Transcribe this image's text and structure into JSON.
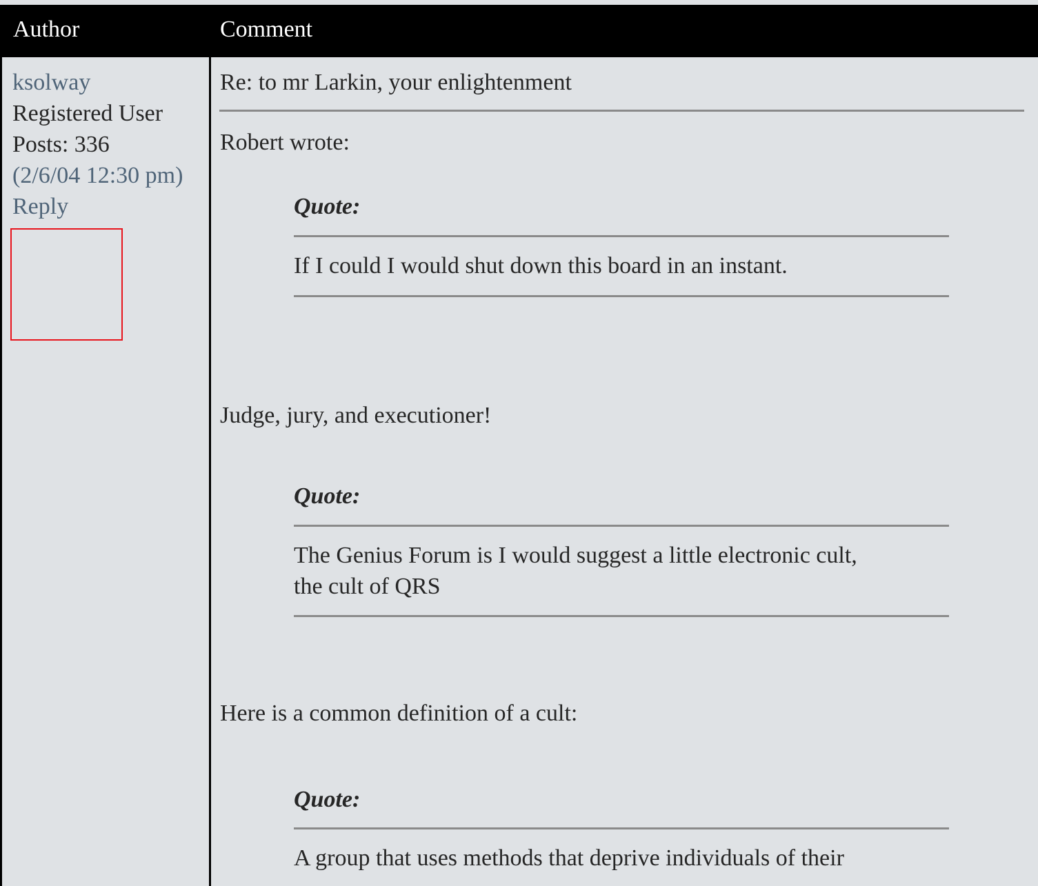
{
  "header": {
    "author_col": "Author",
    "comment_col": "Comment"
  },
  "author": {
    "name": "ksolway",
    "role": "Registered User",
    "posts": "Posts: 336",
    "date": "(2/6/04 12:30 pm)",
    "reply": "Reply"
  },
  "post": {
    "title": "Re: to mr Larkin, your enlightenment",
    "intro": "Robert wrote:",
    "quote1_label": "Quote:",
    "quote1_text": "If I could I would shut down this board in an instant.",
    "response1": "Judge, jury, and executioner!",
    "quote2_label": "Quote:",
    "quote2_lines": [
      "The Genius Forum is I would suggest a little electronic cult,",
      "the cult of QRS"
    ],
    "response2": "Here is a common definition of a cult:",
    "quote3_label": "Quote:",
    "quote3_text": "A group that uses methods that deprive individuals of their"
  }
}
